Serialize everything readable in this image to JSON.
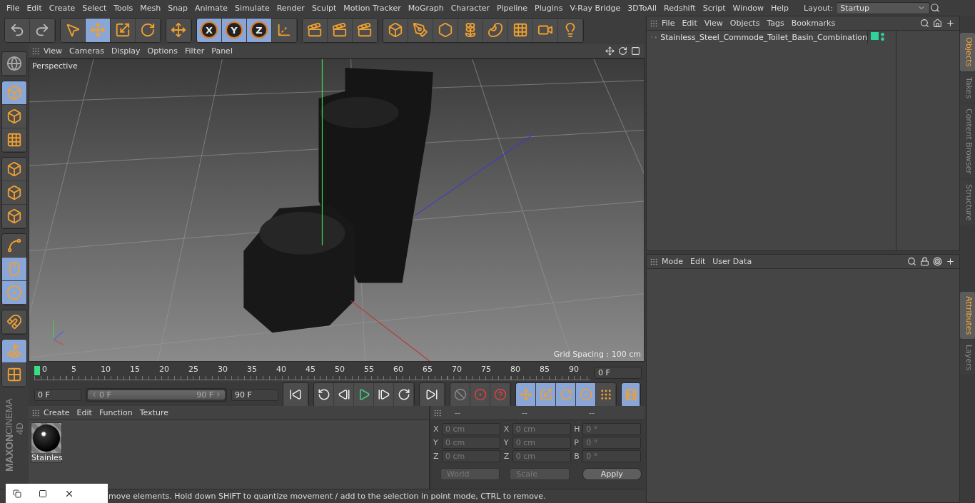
{
  "menubar": {
    "items": [
      "File",
      "Edit",
      "Create",
      "Select",
      "Tools",
      "Mesh",
      "Snap",
      "Animate",
      "Simulate",
      "Render",
      "Sculpt",
      "Motion Tracker",
      "MoGraph",
      "Character",
      "Pipeline",
      "Plugins",
      "V-Ray Bridge",
      "3DToAll",
      "Redshift",
      "Script",
      "Window",
      "Help"
    ],
    "layout_label": "Layout:",
    "layout_value": "Startup"
  },
  "toolbar": {
    "groups": [
      [
        {
          "selected": false
        },
        {
          "selected": false
        }
      ],
      [
        {
          "selected": false
        },
        {
          "selected": true
        },
        {
          "selected": false
        },
        {
          "selected": false
        }
      ],
      [
        {
          "selected": false
        }
      ],
      [
        {
          "label": "X",
          "selected": true
        },
        {
          "label": "Y",
          "selected": true
        },
        {
          "label": "Z",
          "selected": true
        },
        {
          "selected": false
        }
      ],
      [
        {
          "selected": false
        },
        {
          "selected": false
        },
        {
          "selected": false
        }
      ],
      [
        {
          "selected": false
        },
        {
          "selected": false
        },
        {
          "selected": false
        },
        {
          "selected": false
        },
        {
          "selected": false
        },
        {
          "selected": false
        },
        {
          "selected": false
        },
        {
          "selected": false
        }
      ]
    ]
  },
  "left_tools": [
    [
      {
        "selected": false
      }
    ],
    [
      {
        "selected": true
      },
      {
        "selected": false
      },
      {
        "selected": false
      }
    ],
    [
      {
        "selected": false
      },
      {
        "selected": false
      },
      {
        "selected": false
      }
    ],
    [
      {
        "selected": false
      },
      {
        "selected": true
      },
      {
        "selected": true
      }
    ],
    [
      {
        "selected": false
      }
    ],
    [
      {
        "selected": true
      },
      {
        "selected": false
      }
    ]
  ],
  "logo": {
    "brand": "MAXON",
    "product": "CINEMA 4D"
  },
  "viewport": {
    "menu": [
      "View",
      "Cameras",
      "Display",
      "Options",
      "Filter",
      "Panel"
    ],
    "camera": "Perspective",
    "grid_spacing": "Grid Spacing : 100 cm"
  },
  "timeline": {
    "ticks": [
      "0",
      "5",
      "10",
      "15",
      "20",
      "25",
      "30",
      "35",
      "40",
      "45",
      "50",
      "55",
      "60",
      "65",
      "70",
      "75",
      "80",
      "85",
      "90"
    ],
    "playhead": {
      "level": 0
    },
    "current_frame": "0 F"
  },
  "transport": {
    "start": "0 F",
    "range_start": "0 F",
    "range_end": "90 F",
    "end": "90 F",
    "range": {
      "level": 1
    },
    "key_modes": [
      {
        "selected": true
      },
      {
        "selected": true
      },
      {
        "selected": true
      },
      {
        "selected": true
      },
      {
        "selected": false
      }
    ],
    "timeline_button": {
      "selected": true
    }
  },
  "materials": {
    "menu": [
      "Create",
      "Edit",
      "Function",
      "Texture"
    ],
    "items": [
      {
        "name": "Stainles"
      }
    ]
  },
  "coordinates": {
    "headers": [
      "--",
      "--",
      "--"
    ],
    "columns": [
      [
        {
          "axis": "X",
          "value": "0 cm"
        },
        {
          "axis": "Y",
          "value": "0 cm"
        },
        {
          "axis": "Z",
          "value": "0 cm"
        }
      ],
      [
        {
          "axis": "X",
          "value": "0 cm"
        },
        {
          "axis": "Y",
          "value": "0 cm"
        },
        {
          "axis": "Z",
          "value": "0 cm"
        }
      ],
      [
        {
          "axis": "H",
          "value": "0 °"
        },
        {
          "axis": "P",
          "value": "0 °"
        },
        {
          "axis": "B",
          "value": "0 °"
        }
      ]
    ],
    "modes": [
      "World",
      "Scale"
    ],
    "apply": "Apply"
  },
  "status": "move elements. Hold down SHIFT to quantize movement / add to the selection in point mode, CTRL to remove.",
  "objects": {
    "menu": [
      "File",
      "Edit",
      "View",
      "Objects",
      "Tags",
      "Bookmarks"
    ],
    "items": [
      {
        "name": "Stainless_Steel_Commode_Toilet_Basin_Combination",
        "selected": false
      }
    ]
  },
  "attributes": {
    "menu": [
      "Mode",
      "Edit",
      "User Data"
    ]
  },
  "side_tabs_top": [
    {
      "label": "Objects",
      "selected": true
    },
    {
      "label": "Takes",
      "selected": false
    },
    {
      "label": "Content Browser",
      "selected": false
    },
    {
      "label": "Structure",
      "selected": false
    }
  ],
  "side_tabs_bottom": [
    {
      "label": "Attributes",
      "selected": true
    },
    {
      "label": "Layers",
      "selected": false
    }
  ]
}
